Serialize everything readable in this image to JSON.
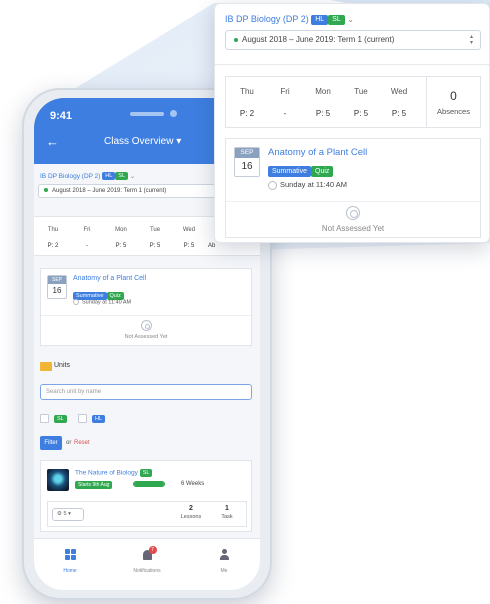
{
  "colors": {
    "accent": "#3d7ee0",
    "green": "#2fa84f",
    "reset": "#d9534f",
    "badge": "#e14b4b"
  },
  "phone": {
    "status_time": "9:41",
    "title": "Class Overview",
    "course": {
      "name": "IB DP Biology (DP 2)",
      "tags": [
        "HL",
        "SL"
      ]
    },
    "term": "August 2018 – June 2019: Term 1 (current)",
    "schedule": {
      "days": [
        "Thu",
        "Fri",
        "Mon",
        "Tue",
        "Wed"
      ],
      "values": [
        "P: 2",
        "-",
        "P: 5",
        "P: 5",
        "P: 5"
      ],
      "cut_text": "Ab"
    },
    "assessment": {
      "month": "SEP",
      "day": "16",
      "title": "Anatomy of a Plant Cell",
      "tags": [
        "Summative",
        "Quiz"
      ],
      "due": "Sunday at 11:40 AM",
      "status": "Not Assessed Yet"
    },
    "units": {
      "heading": "Units",
      "search_placeholder": "Search unit by name",
      "filters": [
        "SL",
        "HL"
      ],
      "filter_button": "Filter",
      "or_text": "or",
      "reset_link": "Reset"
    },
    "unit_card": {
      "title": "The Nature of Biology",
      "tag": "SL",
      "starts": "Starts 9th Aug",
      "progress": 1.0,
      "duration": "6 Weeks",
      "select_value": "5",
      "lessons_count": "2",
      "lessons_label": "Lessons",
      "tasks_count": "1",
      "tasks_label": "Task"
    },
    "nav": {
      "home": "Home",
      "notifications": "Notifications",
      "notifications_badge": "7",
      "me": "Me"
    }
  },
  "popout": {
    "course": {
      "name": "IB DP Biology (DP 2)",
      "tags": [
        "HL",
        "SL"
      ]
    },
    "term": "August 2018 – June 2019: Term 1 (current)",
    "schedule": {
      "days": [
        "Thu",
        "Fri",
        "Mon",
        "Tue",
        "Wed"
      ],
      "values": [
        "P: 2",
        "-",
        "P: 5",
        "P: 5",
        "P: 5"
      ]
    },
    "absences": {
      "count": "0",
      "label": "Absences"
    },
    "assessment": {
      "month": "SEP",
      "day": "16",
      "title": "Anatomy of a Plant Cell",
      "tags": [
        "Summative",
        "Quiz"
      ],
      "due": "Sunday at 11:40 AM",
      "status": "Not Assessed Yet"
    }
  }
}
